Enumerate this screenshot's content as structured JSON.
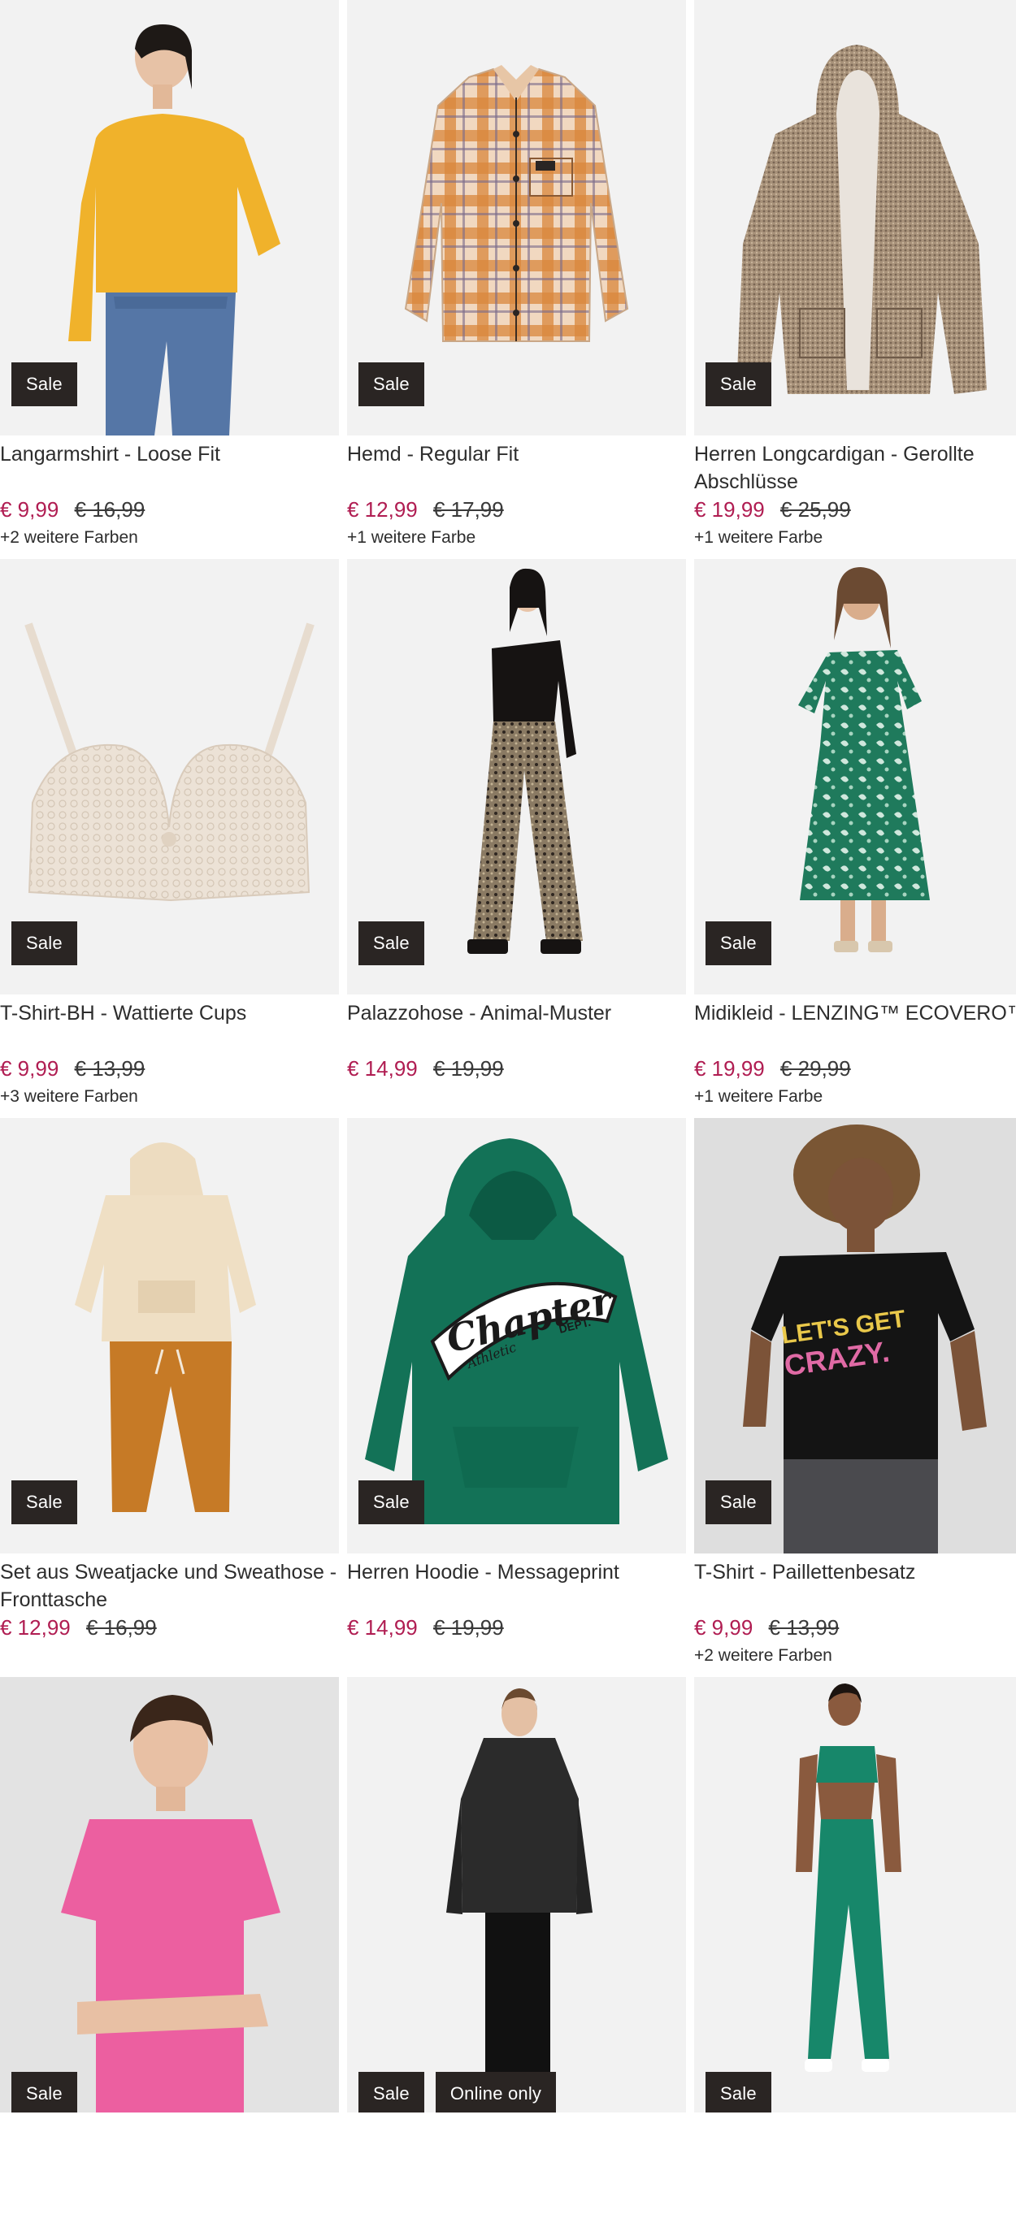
{
  "products": [
    {
      "name": "Langarmshirt - Loose Fit",
      "price": "€ 9,99",
      "old_price": "€ 16,99",
      "colors": "+2 weitere Farben",
      "badges": [
        "Sale"
      ],
      "icon": "yellow-longsleeve-model"
    },
    {
      "name": "Hemd - Regular Fit",
      "price": "€ 12,99",
      "old_price": "€ 17,99",
      "colors": "+1 weitere Farbe",
      "badges": [
        "Sale"
      ],
      "icon": "plaid-shirt"
    },
    {
      "name": "Herren Longcardigan - Gerollte Abschlüsse",
      "price": "€ 19,99",
      "old_price": "€ 25,99",
      "colors": "+1 weitere Farbe",
      "badges": [
        "Sale"
      ],
      "icon": "knit-cardigan"
    },
    {
      "name": "T-Shirt-BH - Wattierte Cups",
      "price": "€ 9,99",
      "old_price": "€ 13,99",
      "colors": "+3 weitere Farben",
      "badges": [
        "Sale"
      ],
      "icon": "lace-bra"
    },
    {
      "name": "Palazzohose - Animal-Muster",
      "price": "€ 14,99",
      "old_price": "€ 19,99",
      "colors": "",
      "badges": [
        "Sale"
      ],
      "icon": "palazzo-pants-model"
    },
    {
      "name": "Midikleid - LENZING™ ECOVERO™",
      "price": "€ 19,99",
      "old_price": "€ 29,99",
      "colors": "+1 weitere Farbe",
      "badges": [
        "Sale"
      ],
      "icon": "green-dress-model"
    },
    {
      "name": "Set aus Sweatjacke und Sweathose - Fronttasche",
      "price": "€ 12,99",
      "old_price": "€ 16,99",
      "colors": "",
      "badges": [
        "Sale"
      ],
      "icon": "baby-sweat-set"
    },
    {
      "name": "Herren Hoodie - Messageprint",
      "price": "€ 14,99",
      "old_price": "€ 19,99",
      "colors": "",
      "badges": [
        "Sale"
      ],
      "icon": "green-hoodie"
    },
    {
      "name": "T-Shirt - Paillettenbesatz",
      "price": "€ 9,99",
      "old_price": "€ 13,99",
      "colors": "+2 weitere Farben",
      "badges": [
        "Sale"
      ],
      "icon": "black-tshirt-model"
    },
    {
      "name": "",
      "price": "",
      "old_price": "",
      "colors": "",
      "badges": [
        "Sale"
      ],
      "icon": "pink-shirt-model"
    },
    {
      "name": "",
      "price": "",
      "old_price": "",
      "colors": "",
      "badges": [
        "Sale",
        "Online only"
      ],
      "icon": "rain-jacket-model"
    },
    {
      "name": "",
      "price": "",
      "old_price": "",
      "colors": "",
      "badges": [
        "Sale"
      ],
      "icon": "green-activewear-model"
    }
  ],
  "hoodie_print": {
    "line1": "Chapter",
    "line2": "DEPT.",
    "line3": "Athletic"
  },
  "tshirt_print": {
    "line1": "LET'S GET",
    "line2": "CRAZY."
  },
  "colors": {
    "sale_price": "#b01d52",
    "badge_bg": "#2a2523"
  }
}
